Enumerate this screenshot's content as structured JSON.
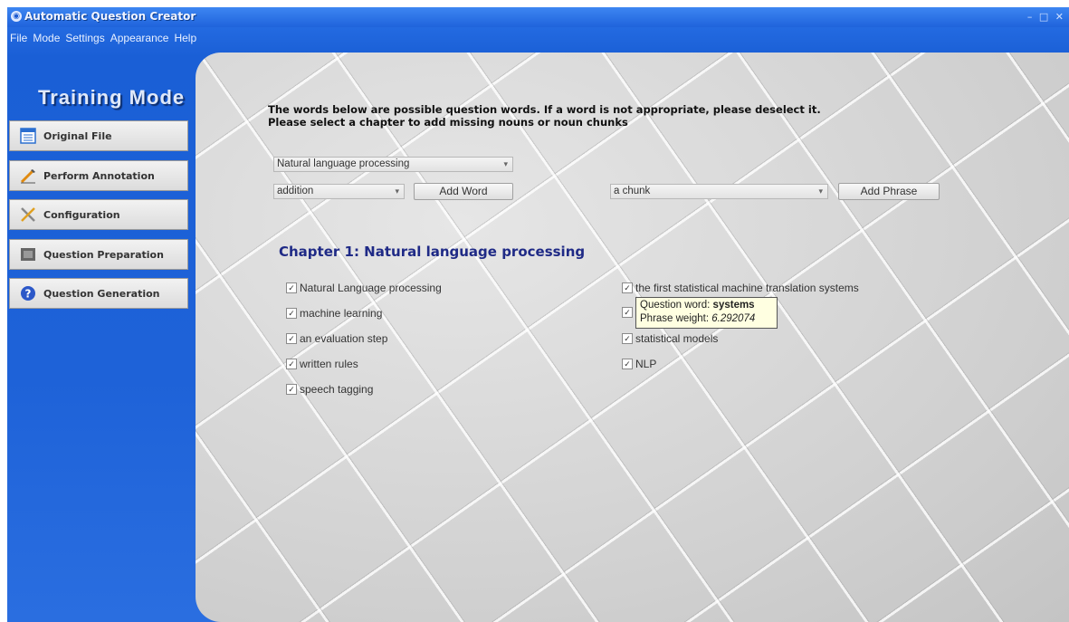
{
  "window": {
    "title": "Automatic Question Creator",
    "controls": "– □ ✕"
  },
  "menu": [
    "File",
    "Mode",
    "Settings",
    "Appearance",
    "Help"
  ],
  "sidebar": {
    "title": "Training Mode",
    "items": [
      {
        "label": "Original File",
        "icon": "document-list-icon"
      },
      {
        "label": "Perform Annotation",
        "icon": "pen-annotation-icon"
      },
      {
        "label": "Configuration",
        "icon": "tools-icon"
      },
      {
        "label": "Question Preparation",
        "icon": "film-icon"
      },
      {
        "label": "Question Generation",
        "icon": "question-icon"
      }
    ]
  },
  "main": {
    "instruction_line1": "The words below are possible question words. If a word is not appropriate, please deselect it.",
    "instruction_line2": "Please select a chapter to add missing nouns or noun chunks",
    "chapter_select": "Natural language processing",
    "word_select": "addition",
    "add_word_label": "Add Word",
    "phrase_select": "a chunk",
    "add_phrase_label": "Add Phrase",
    "chapter_heading": "Chapter 1: Natural language processing",
    "left_items": [
      {
        "label": "Natural Language processing",
        "checked": true
      },
      {
        "label": "machine learning",
        "checked": true
      },
      {
        "label": "an evaluation step",
        "checked": true
      },
      {
        "label": "written rules",
        "checked": true
      },
      {
        "label": "speech tagging",
        "checked": true
      }
    ],
    "right_items": [
      {
        "label": "the first statistical machine translation systems",
        "checked": true
      },
      {
        "label": "",
        "checked": true
      },
      {
        "label": "statistical models",
        "checked": true
      },
      {
        "label": "NLP",
        "checked": true
      }
    ],
    "tooltip": {
      "word_prefix": "Question word: ",
      "word": "systems",
      "weight_prefix": "Phrase weight: ",
      "weight": "6.292074"
    }
  },
  "colors": {
    "window_blue": "#1e62d8",
    "chapter_heading": "#1f2a86",
    "tooltip_bg": "#ffffe1"
  }
}
